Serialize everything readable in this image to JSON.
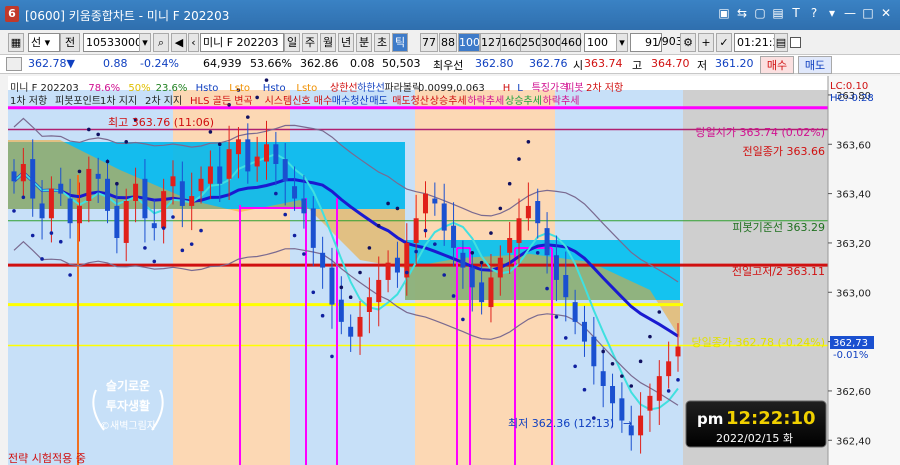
{
  "window": {
    "app_number": "6",
    "title": "[0600] 키움종합차트 - 미니 F 202203"
  },
  "toolbar": {
    "type_select": "선",
    "code_label": "전",
    "account_code": "10533000",
    "instrument_name": "미니 F 202203",
    "periods": [
      "일",
      "주",
      "월",
      "년",
      "분",
      "초",
      "틱"
    ],
    "active_period": "틱",
    "tick_options": [
      "77",
      "88",
      "100",
      "127",
      "160",
      "250",
      "300",
      "460"
    ],
    "active_tick": "100",
    "count_value": "100",
    "page_value": "91",
    "page_total": "/903",
    "clock_value": "01:21:30"
  },
  "quote": {
    "last": "362.78▼",
    "change": "0.88",
    "change_pct": "-0.24%",
    "volume": "64,939",
    "volume_ratio": "53.66%",
    "value1": "362.86",
    "value2": "0.08",
    "value3": "50,503",
    "best_label": "최우선",
    "best_bid": "362.80",
    "best_ask": "362.76",
    "open_label": "시",
    "open": "363.74",
    "high_label": "고",
    "high": "364.70",
    "low_label": "저",
    "low": "361.20",
    "buy_label": "매수",
    "sell_label": "매도"
  },
  "legend": {
    "row1": [
      "미니 F 202203",
      "78.6%",
      "50%",
      "23.6%",
      "Hsto",
      "Lsto",
      "Hsto",
      "Lsto",
      "상한선",
      "하한선",
      "파라볼릭",
      "0.0099,0.063",
      "H",
      "L",
      "특징가격",
      "피봇",
      "2차 저항"
    ],
    "row2": [
      "1차 저항",
      "피봇포인트",
      "1차 지지",
      "2차 지지",
      "HLS 골든 변곡",
      "시스템신호 매수",
      "매수청산",
      "매도",
      "매도청산",
      "상승추세",
      "하락추세",
      "상승추세",
      "하락추세"
    ],
    "lc": "LC:0.10",
    "hc": "HC:-0.28"
  },
  "annotations": {
    "high_mark": "최고 363.76 (11:06)",
    "low_mark": "최저 362.36 (12:13)",
    "today_open": "당일시가 363.74 (0.02%)",
    "prev_close": "전일종가 363.66",
    "pivot": "피봇기준선 363.29",
    "prev_hl2": "전일고저/2 363.11",
    "today_close": "당일종가 362.78 (-0.24%)",
    "strategy": "전략 시험적용 중",
    "watermark_line1": "슬기로운",
    "watermark_line2": "투자생활",
    "watermark_line3": "©새벽그림자"
  },
  "clock": {
    "ampm": "pm",
    "time": "12:22:10",
    "date": "2022/02/15 화"
  },
  "price_axis": {
    "labels": [
      "363,80",
      "363,60",
      "363,40",
      "363,20",
      "363,00",
      "362,80",
      "362,60",
      "362,40"
    ],
    "current_tag": "362,73",
    "current_pct": "-0.01%"
  },
  "chart_data": {
    "type": "candlestick",
    "instrument": "미니 F 202203",
    "ylim": [
      362.32,
      363.82
    ],
    "ticks": [
      363.8,
      363.6,
      363.4,
      363.2,
      363.0,
      362.8,
      362.6,
      362.4
    ],
    "levels": {
      "today_open": 363.74,
      "prev_close": 363.66,
      "pivot": 363.29,
      "prev_hl2": 363.11,
      "today_close": 362.78,
      "support_yellow": 362.95
    },
    "candles_close": [
      363.45,
      363.52,
      363.38,
      363.3,
      363.42,
      363.4,
      363.28,
      363.35,
      363.5,
      363.46,
      363.33,
      363.22,
      363.37,
      363.44,
      363.3,
      363.26,
      363.41,
      363.47,
      363.35,
      363.39,
      363.46,
      363.51,
      363.44,
      363.58,
      363.62,
      363.49,
      363.55,
      363.6,
      363.52,
      363.45,
      363.38,
      363.32,
      363.18,
      363.1,
      362.95,
      362.88,
      362.82,
      362.9,
      362.98,
      363.05,
      363.12,
      363.08,
      363.2,
      363.3,
      363.4,
      363.36,
      363.25,
      363.18,
      363.1,
      363.02,
      362.96,
      363.06,
      363.14,
      363.22,
      363.3,
      363.35,
      363.28,
      363.15,
      363.05,
      362.98,
      362.88,
      362.8,
      362.7,
      362.62,
      362.55,
      362.48,
      362.42,
      362.5,
      362.58,
      362.66,
      362.72,
      362.78
    ],
    "series_names": [
      "이평(단기)",
      "이평(장기)",
      "상한선",
      "하한선",
      "파라볼릭"
    ]
  },
  "colors": {
    "title_bar": "#2f6fae",
    "up": "#e0201a",
    "down": "#1a50d0",
    "band_fill": "#00c0ee",
    "magenta": "#ff00ff",
    "level_red": "#d01010",
    "level_yellow": "#ffff00",
    "ma_long": "#1a1ad0",
    "ma_short": "#40e0e0"
  }
}
